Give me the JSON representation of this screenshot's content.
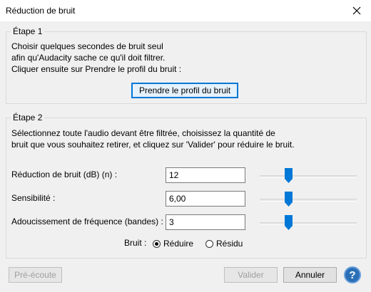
{
  "window": {
    "title": "Réduction de bruit",
    "close_icon": "close-icon"
  },
  "step1": {
    "legend": "Étape 1",
    "line1": "Choisir quelques secondes de bruit seul",
    "line2": "afin qu'Audacity sache ce qu'il doit filtrer.",
    "line3": "Cliquer ensuite sur Prendre le profil du bruit :",
    "profile_button": "Prendre le profil du bruit"
  },
  "step2": {
    "legend": "Étape 2",
    "line1": "Sélectionnez toute l'audio devant être filtrée, choisissez la quantité de",
    "line2": "bruit que vous souhaitez retirer, et cliquez sur 'Valider' pour réduire le bruit.",
    "params": [
      {
        "label": "Réduction de bruit (dB) (n) :",
        "value": "12",
        "slider_fraction": 0.28
      },
      {
        "label": "Sensibilité :",
        "value": "6,00",
        "slider_fraction": 0.28
      },
      {
        "label": "Adoucissement de fréquence (bandes) :",
        "value": "3",
        "slider_fraction": 0.28
      }
    ],
    "noise_label": "Bruit :",
    "radio_reduce": "Réduire",
    "radio_residue": "Résidu",
    "selected_radio": "reduce"
  },
  "footer": {
    "preview": "Pré-écoute",
    "ok": "Valider",
    "cancel": "Annuler",
    "help": "?"
  },
  "colors": {
    "accent": "#0078d7",
    "slider_thumb": "#0078d7",
    "help_bg": "#2b6fb6"
  }
}
